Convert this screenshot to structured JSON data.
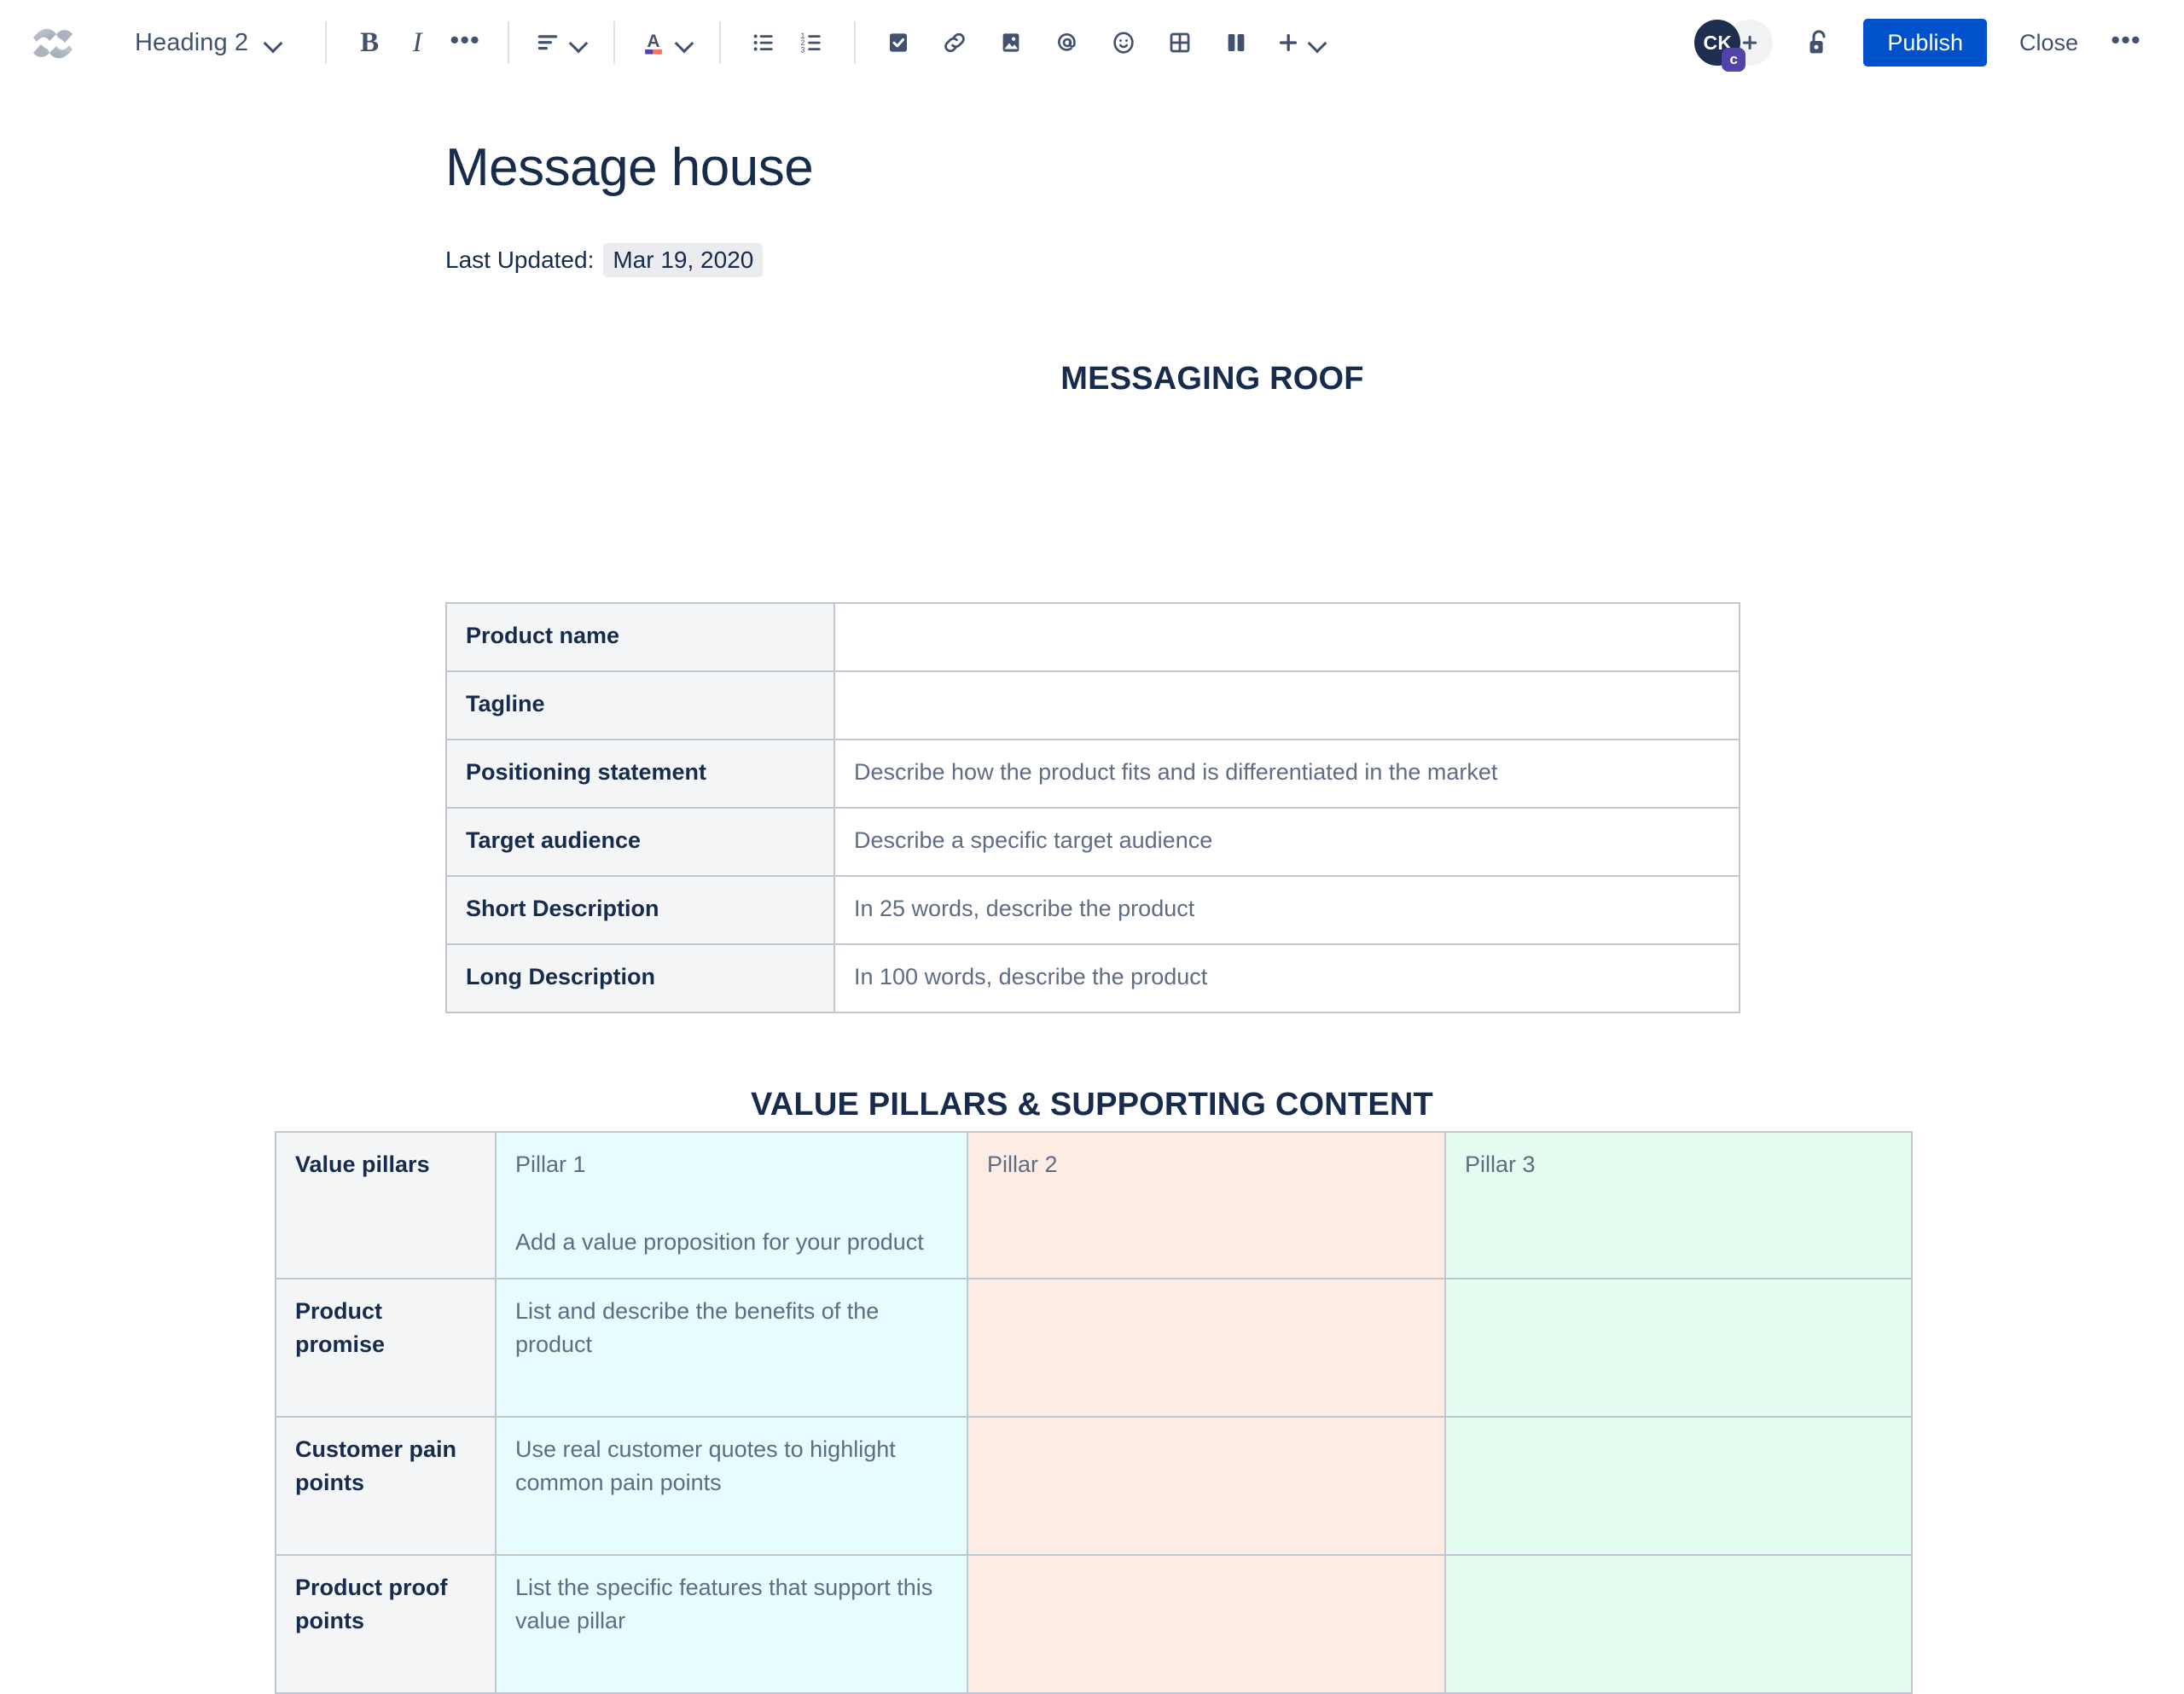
{
  "toolbar": {
    "logo_name": "confluence-logo",
    "block_type": "Heading 2",
    "bold_label": "B",
    "italic_label": "I",
    "more_formatting_label": "•••",
    "more_options_label": "•••",
    "publish_label": "Publish",
    "close_label": "Close",
    "avatar_initials": "CK",
    "avatar_badge_initial": "c",
    "accent_color": "#0052cc",
    "icons": [
      "bullet-list-icon",
      "numbered-list-icon",
      "task-list-icon",
      "link-icon",
      "image-icon",
      "mention-icon",
      "emoji-icon",
      "table-icon",
      "layout-icon",
      "insert-plus-icon"
    ]
  },
  "document": {
    "title": "Message house",
    "last_updated_label": "Last Updated:",
    "last_updated_value": "Mar 19, 2020"
  },
  "roof": {
    "heading": "MESSAGING ROOF",
    "rows": [
      {
        "label": "Product name",
        "value": ""
      },
      {
        "label": "Tagline",
        "value": ""
      },
      {
        "label": "Positioning statement",
        "value": "Describe how the product fits and is differentiated in the market"
      },
      {
        "label": "Target audience",
        "value": "Describe a specific target audience"
      },
      {
        "label": "Short Description",
        "value": "In 25 words, describe the product"
      },
      {
        "label": "Long Description",
        "value": "In 100 words, describe the product"
      }
    ]
  },
  "pillars": {
    "heading": "VALUE PILLARS & SUPPORTING CONTENT",
    "row_labels": [
      "Value pillars",
      "Product promise",
      "Customer pain points",
      "Product proof points"
    ],
    "pillar_titles": [
      "Pillar 1",
      "Pillar 2",
      "Pillar 3"
    ],
    "pillar_colors": [
      "#e6fcff",
      "#fdece4",
      "#e3fcef"
    ],
    "pillar1": {
      "value_pillars": "Add a value proposition for your product",
      "product_promise": "List and describe the benefits of the product",
      "customer_pain_points": "Use real customer quotes to highlight common pain points",
      "product_proof_points": "List the specific features that support this value pillar"
    },
    "pillar2": {
      "value_pillars": "",
      "product_promise": "",
      "customer_pain_points": "",
      "product_proof_points": ""
    },
    "pillar3": {
      "value_pillars": "",
      "product_promise": "",
      "customer_pain_points": "",
      "product_proof_points": ""
    }
  }
}
